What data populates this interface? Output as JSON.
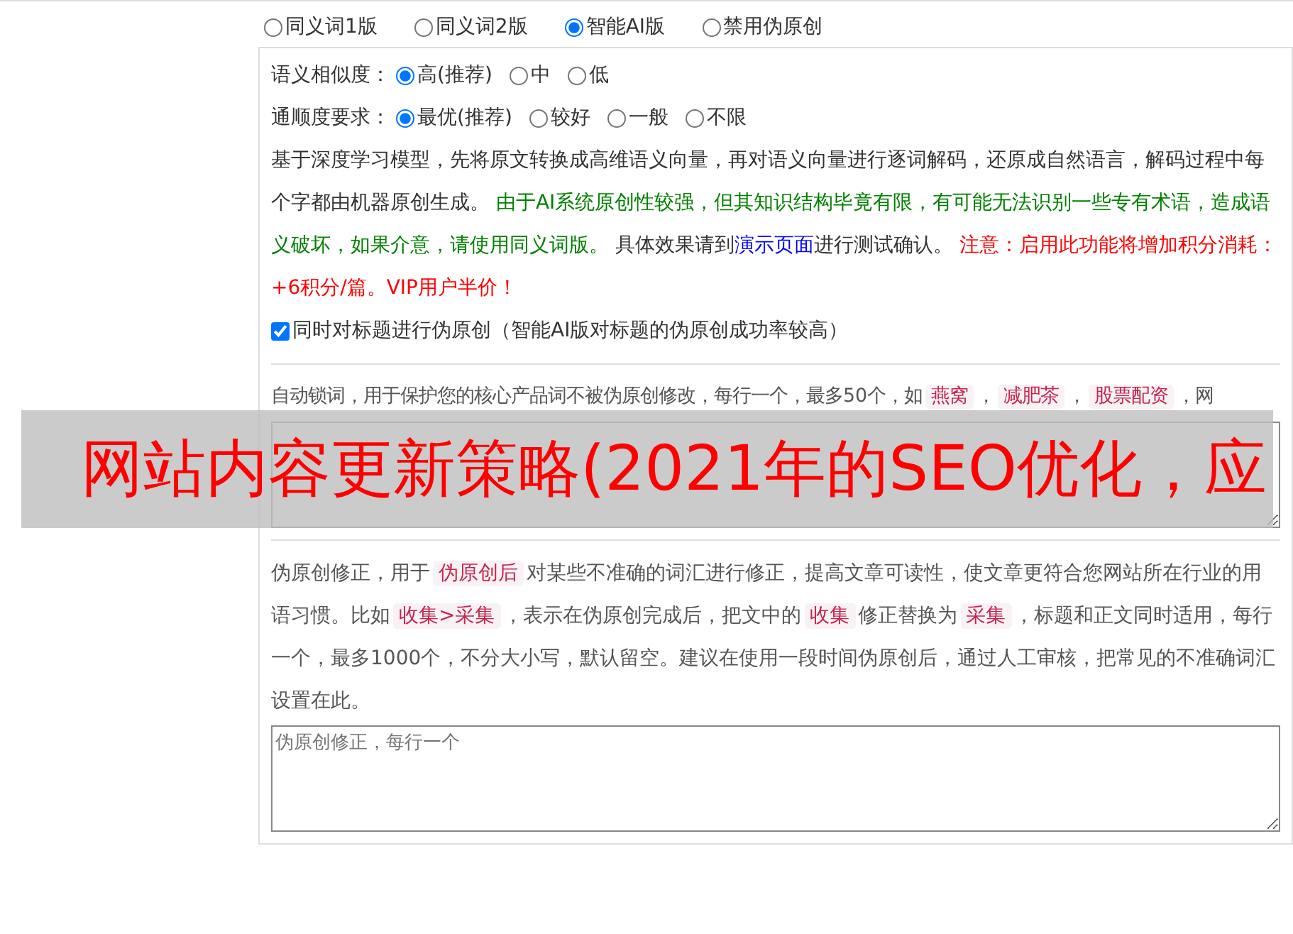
{
  "version_options": [
    {
      "label": "同义词1版",
      "selected": false
    },
    {
      "label": "同义词2版",
      "selected": false
    },
    {
      "label": "智能AI版",
      "selected": true
    },
    {
      "label": "禁用伪原创",
      "selected": false
    }
  ],
  "ai_settings": {
    "rows": [
      {
        "label": "语义相似度：",
        "options": [
          {
            "label": "高(推荐)",
            "selected": true
          },
          {
            "label": "中",
            "selected": false
          },
          {
            "label": "低",
            "selected": false
          }
        ]
      },
      {
        "label": "通顺度要求：",
        "options": [
          {
            "label": "最优(推荐)",
            "selected": true
          },
          {
            "label": "较好",
            "selected": false
          },
          {
            "label": "一般",
            "selected": false
          },
          {
            "label": "不限",
            "selected": false
          }
        ]
      }
    ],
    "description": [
      {
        "kind": "text",
        "text": "基于深度学习模型，先将原文转换成高维语义向量，再对语义向量进行逐词解码，还原成自然语言，解码过程中每个字都由机器原创生成。 "
      },
      {
        "kind": "notice",
        "text": "由于AI系统原创性较强，但其知识结构毕竟有限，有可能无法识别一些专有术语，造成语义破坏，如果介意，请使用同义词版。"
      },
      {
        "kind": "text",
        "text": " 具体效果请到"
      },
      {
        "kind": "link",
        "text": "演示页面"
      },
      {
        "kind": "text",
        "text": "进行测试确认。 "
      },
      {
        "kind": "warning",
        "text": "注意：启用此功能将增加积分消耗：+6积分/篇。VIP用户半价！"
      }
    ],
    "title_checkbox": {
      "label": "同时对标题进行伪原创（智能AI版对标题的伪原创成功率较高）",
      "checked": true
    }
  },
  "lock_words": {
    "intro": [
      {
        "kind": "text",
        "text": "自动锁词，用于保护您的核心产品词不被伪原创修改，每行一个，最多50个，如"
      },
      {
        "kind": "tag",
        "text": "燕窝"
      },
      {
        "kind": "text",
        "text": "，"
      },
      {
        "kind": "tag",
        "text": "减肥茶"
      },
      {
        "kind": "text",
        "text": "，"
      },
      {
        "kind": "tag",
        "text": "股票配资"
      },
      {
        "kind": "text",
        "text": "，网"
      }
    ]
  },
  "correction": {
    "intro": [
      {
        "kind": "text",
        "text": "伪原创修正，用于"
      },
      {
        "kind": "tag",
        "text": "伪原创后"
      },
      {
        "kind": "text",
        "text": "对某些不准确的词汇进行修正，提高文章可读性，使文章更符合您网站所在行业的用语习惯。比如"
      },
      {
        "kind": "tag",
        "text": "收集>采集"
      },
      {
        "kind": "text",
        "text": "，表示在伪原创完成后，把文中的"
      },
      {
        "kind": "tag",
        "text": "收集"
      },
      {
        "kind": "text",
        "text": "修正替换为"
      },
      {
        "kind": "tag",
        "text": "采集"
      },
      {
        "kind": "text",
        "text": "，标题和正文同时适用，每行一个，最多1000个，不分大小写，默认留空。建议在使用一段时间伪原创后，通过人工审核，把常见的不准确词汇设置在此。"
      }
    ],
    "placeholder": "伪原创修正，每行一个"
  },
  "banner": "网站内容更新策略(2021年的SEO优化，应"
}
